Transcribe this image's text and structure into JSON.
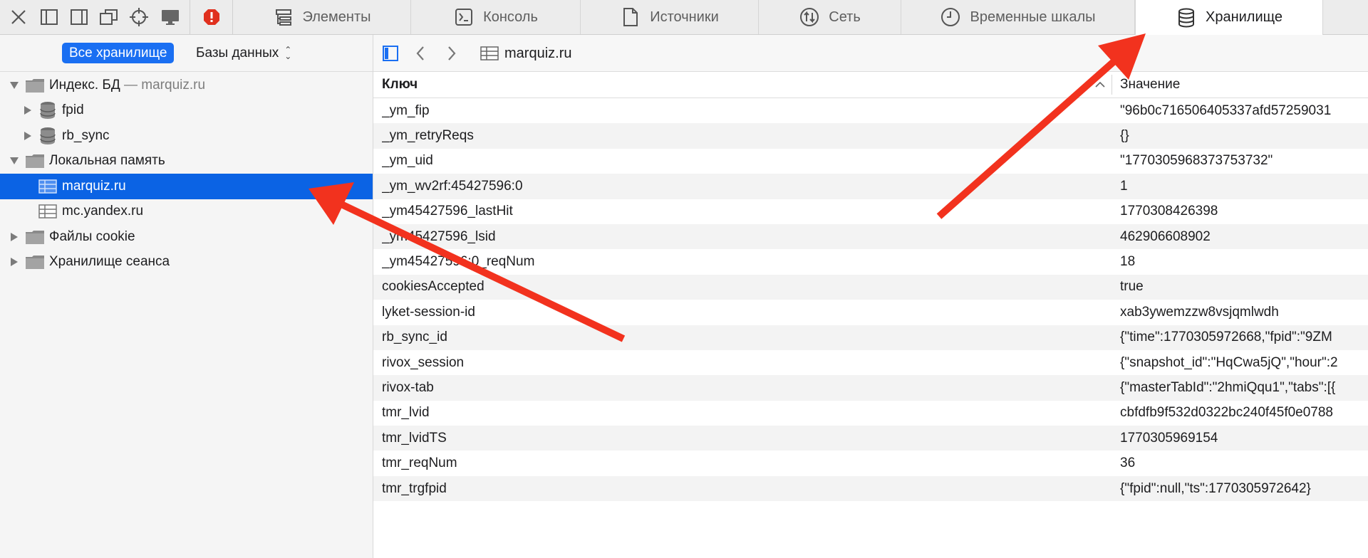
{
  "toolbar": {
    "tabs": [
      {
        "label": "Элементы",
        "icon": "elements-icon"
      },
      {
        "label": "Консоль",
        "icon": "console-icon"
      },
      {
        "label": "Источники",
        "icon": "sources-icon"
      },
      {
        "label": "Сеть",
        "icon": "network-icon"
      },
      {
        "label": "Временные шкалы",
        "icon": "timelines-icon"
      },
      {
        "label": "Хранилище",
        "icon": "storage-icon",
        "active": true
      }
    ],
    "colors": {
      "error_badge": "#e0301e",
      "active_tab_bg": "#ffffff"
    }
  },
  "sidebar": {
    "filter_all": "Все хранилище",
    "filter_select": "Базы данных",
    "tree": [
      {
        "label": "Индекс. БД",
        "sub": " — marquiz.ru",
        "level": 0,
        "expanded": true,
        "icon": "folder-icon"
      },
      {
        "label": "fpid",
        "level": 1,
        "expanded": false,
        "icon": "database-icon"
      },
      {
        "label": "rb_sync",
        "level": 1,
        "expanded": false,
        "icon": "database-icon"
      },
      {
        "label": "Локальная память",
        "level": 0,
        "expanded": true,
        "icon": "folder-icon"
      },
      {
        "label": "marquiz.ru",
        "level": 1,
        "selected": true,
        "icon": "table-icon"
      },
      {
        "label": "mc.yandex.ru",
        "level": 1,
        "icon": "table-icon"
      },
      {
        "label": "Файлы cookie",
        "level": 0,
        "expanded": false,
        "icon": "folder-icon"
      },
      {
        "label": "Хранилище сеанса",
        "level": 0,
        "expanded": false,
        "icon": "folder-icon"
      }
    ],
    "colors": {
      "selected": "#0b63e4",
      "pill": "#1a6ff2"
    }
  },
  "main": {
    "breadcrumb": "marquiz.ru",
    "columns": {
      "key": "Ключ",
      "value": "Значение"
    },
    "rows": [
      {
        "key": "_ym_fip",
        "value": "\"96b0c716506405337afd57259031"
      },
      {
        "key": "_ym_retryReqs",
        "value": "{}"
      },
      {
        "key": "_ym_uid",
        "value": "\"1770305968373753732\""
      },
      {
        "key": "_ym_wv2rf:45427596:0",
        "value": "1"
      },
      {
        "key": "_ym45427596_lastHit",
        "value": "1770308426398"
      },
      {
        "key": "_ym45427596_lsid",
        "value": "462906608902"
      },
      {
        "key": "_ym45427596:0_reqNum",
        "value": "18"
      },
      {
        "key": "cookiesAccepted",
        "value": "true"
      },
      {
        "key": "lyket-session-id",
        "value": "xab3ywemzzw8vsjqmlwdh"
      },
      {
        "key": "rb_sync_id",
        "value": "{\"time\":1770305972668,\"fpid\":\"9ZM"
      },
      {
        "key": "rivox_session",
        "value": "{\"snapshot_id\":\"HqCwa5jQ\",\"hour\":2"
      },
      {
        "key": "rivox-tab",
        "value": "{\"masterTabId\":\"2hmiQqu1\",\"tabs\":[{"
      },
      {
        "key": "tmr_lvid",
        "value": "cbfdfb9f532d0322bc240f45f0e0788"
      },
      {
        "key": "tmr_lvidTS",
        "value": "1770305969154"
      },
      {
        "key": "tmr_reqNum",
        "value": "36"
      },
      {
        "key": "tmr_trgfpid",
        "value": "{\"fpid\":null,\"ts\":1770305972642}"
      }
    ]
  },
  "annotations": {
    "arrow_color": "#f2321e"
  }
}
